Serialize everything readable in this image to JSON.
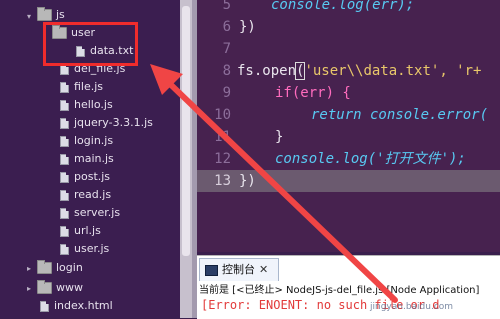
{
  "explorer": {
    "items": [
      {
        "label": "js",
        "kind": "folder",
        "expanded": true
      },
      {
        "label": "user",
        "kind": "folder",
        "expanded": true
      },
      {
        "label": "data.txt",
        "kind": "file"
      },
      {
        "label": "del_file.js",
        "kind": "file"
      },
      {
        "label": "file.js",
        "kind": "file"
      },
      {
        "label": "hello.js",
        "kind": "file"
      },
      {
        "label": "jquery-3.3.1.js",
        "kind": "file"
      },
      {
        "label": "login.js",
        "kind": "file"
      },
      {
        "label": "main.js",
        "kind": "file"
      },
      {
        "label": "post.js",
        "kind": "file"
      },
      {
        "label": "read.js",
        "kind": "file"
      },
      {
        "label": "server.js",
        "kind": "file"
      },
      {
        "label": "url.js",
        "kind": "file"
      },
      {
        "label": "user.js",
        "kind": "file"
      },
      {
        "label": "login",
        "kind": "folder",
        "expanded": false
      },
      {
        "label": "www",
        "kind": "folder",
        "expanded": false
      },
      {
        "label": "index.html",
        "kind": "file"
      }
    ]
  },
  "editor": {
    "lines": [
      {
        "num": "5",
        "text": "console.log(err);"
      },
      {
        "num": "6",
        "text": "})"
      },
      {
        "num": "7",
        "text": ""
      },
      {
        "num": "8",
        "text": "fs.open('user\\\\data.txt', 'r+"
      },
      {
        "num": "9",
        "text": "if(err) {"
      },
      {
        "num": "10",
        "text": "return console.error("
      },
      {
        "num": "11",
        "text": "}"
      },
      {
        "num": "12",
        "text": "console.log('打开文件');"
      },
      {
        "num": "13",
        "text": "})"
      }
    ]
  },
  "console": {
    "tab_label": "控制台",
    "close_symbol": "✕",
    "status": "当前是 [<已终止> NodeJS-js-del_file.js [Node Application]",
    "error": "[Error: ENOENT: no such file or d"
  },
  "watermark": "jingyan.baidu.com",
  "colors": {
    "highlight_box": "#f02c2c",
    "arrow": "#f04545",
    "editor_bg": "#47224f",
    "current_line": "#6b5a6f"
  }
}
